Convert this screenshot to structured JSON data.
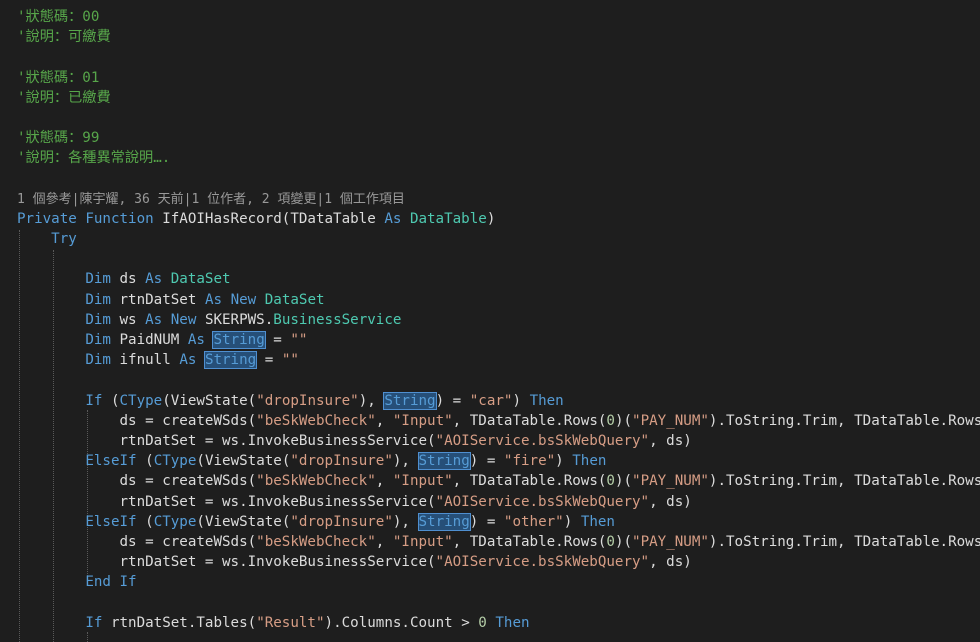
{
  "editor": {
    "lines": [
      [
        {
          "t": "'狀態碼：00",
          "c": "comment"
        }
      ],
      [
        {
          "t": "'說明：可繳費",
          "c": "comment"
        }
      ],
      [],
      [
        {
          "t": "'狀態碼：01",
          "c": "comment"
        }
      ],
      [
        {
          "t": "'說明：已繳費",
          "c": "comment"
        }
      ],
      [],
      [
        {
          "t": "'狀態碼：99",
          "c": "comment"
        }
      ],
      [
        {
          "t": "'說明：各種異常說明….",
          "c": "comment"
        }
      ],
      [],
      [
        {
          "t": "1 個參考|陳宇耀, 36 天前|1 位作者, 2 項變更|1 個工作項目",
          "c": "codelens"
        }
      ],
      [
        {
          "t": "Private ",
          "c": "kw"
        },
        {
          "t": "Function ",
          "c": "kw"
        },
        {
          "t": "IfAOIHasRecord(TDataTable ",
          "c": "plain"
        },
        {
          "t": "As ",
          "c": "kw"
        },
        {
          "t": "DataTable",
          "c": "type"
        },
        {
          "t": ")",
          "c": "plain"
        }
      ],
      [
        {
          "t": "    ",
          "c": "plain"
        },
        {
          "t": "Try",
          "c": "kw"
        }
      ],
      [],
      [
        {
          "t": "        ",
          "c": "plain"
        },
        {
          "t": "Dim ",
          "c": "kw"
        },
        {
          "t": "ds ",
          "c": "plain"
        },
        {
          "t": "As ",
          "c": "kw"
        },
        {
          "t": "DataSet",
          "c": "type"
        }
      ],
      [
        {
          "t": "        ",
          "c": "plain"
        },
        {
          "t": "Dim ",
          "c": "kw"
        },
        {
          "t": "rtnDatSet ",
          "c": "plain"
        },
        {
          "t": "As ",
          "c": "kw"
        },
        {
          "t": "New ",
          "c": "kw"
        },
        {
          "t": "DataSet",
          "c": "type"
        }
      ],
      [
        {
          "t": "        ",
          "c": "plain"
        },
        {
          "t": "Dim ",
          "c": "kw"
        },
        {
          "t": "ws ",
          "c": "plain"
        },
        {
          "t": "As ",
          "c": "kw"
        },
        {
          "t": "New ",
          "c": "kw"
        },
        {
          "t": "SKERPWS.",
          "c": "plain"
        },
        {
          "t": "BusinessService",
          "c": "type"
        }
      ],
      [
        {
          "t": "        ",
          "c": "plain"
        },
        {
          "t": "Dim ",
          "c": "kw"
        },
        {
          "t": "PaidNUM ",
          "c": "plain"
        },
        {
          "t": "As ",
          "c": "kw"
        },
        {
          "t": "String",
          "c": "hl"
        },
        {
          "t": " = ",
          "c": "plain"
        },
        {
          "t": "\"\"",
          "c": "str"
        }
      ],
      [
        {
          "t": "        ",
          "c": "plain"
        },
        {
          "t": "Dim ",
          "c": "kw"
        },
        {
          "t": "ifnull ",
          "c": "plain"
        },
        {
          "t": "As ",
          "c": "kw"
        },
        {
          "t": "String",
          "c": "hl"
        },
        {
          "t": " = ",
          "c": "plain"
        },
        {
          "t": "\"\"",
          "c": "str"
        }
      ],
      [],
      [
        {
          "t": "        ",
          "c": "plain"
        },
        {
          "t": "If ",
          "c": "kw"
        },
        {
          "t": "(",
          "c": "plain"
        },
        {
          "t": "CType",
          "c": "kw"
        },
        {
          "t": "(ViewState(",
          "c": "plain"
        },
        {
          "t": "\"dropInsure\"",
          "c": "str"
        },
        {
          "t": "), ",
          "c": "plain"
        },
        {
          "t": "String",
          "c": "hl"
        },
        {
          "t": ") = ",
          "c": "plain"
        },
        {
          "t": "\"car\"",
          "c": "str"
        },
        {
          "t": ") ",
          "c": "plain"
        },
        {
          "t": "Then",
          "c": "kw"
        }
      ],
      [
        {
          "t": "            ds = createWSds(",
          "c": "plain"
        },
        {
          "t": "\"beSkWebCheck\"",
          "c": "str"
        },
        {
          "t": ", ",
          "c": "plain"
        },
        {
          "t": "\"Input\"",
          "c": "str"
        },
        {
          "t": ", TDataTable.Rows(",
          "c": "plain"
        },
        {
          "t": "0",
          "c": "num"
        },
        {
          "t": ")(",
          "c": "plain"
        },
        {
          "t": "\"PAY_NUM\"",
          "c": "str"
        },
        {
          "t": ").ToString.Trim, TDataTable.Rows(",
          "c": "plain"
        }
      ],
      [
        {
          "t": "            rtnDatSet = ws.InvokeBusinessService(",
          "c": "plain"
        },
        {
          "t": "\"AOIService.bsSkWebQuery\"",
          "c": "str"
        },
        {
          "t": ", ds)",
          "c": "plain"
        }
      ],
      [
        {
          "t": "        ",
          "c": "plain"
        },
        {
          "t": "ElseIf ",
          "c": "kw"
        },
        {
          "t": "(",
          "c": "plain"
        },
        {
          "t": "CType",
          "c": "kw"
        },
        {
          "t": "(ViewState(",
          "c": "plain"
        },
        {
          "t": "\"dropInsure\"",
          "c": "str"
        },
        {
          "t": "), ",
          "c": "plain"
        },
        {
          "t": "String",
          "c": "hl"
        },
        {
          "t": ") = ",
          "c": "plain"
        },
        {
          "t": "\"fire\"",
          "c": "str"
        },
        {
          "t": ") ",
          "c": "plain"
        },
        {
          "t": "Then",
          "c": "kw"
        }
      ],
      [
        {
          "t": "            ds = createWSds(",
          "c": "plain"
        },
        {
          "t": "\"beSkWebCheck\"",
          "c": "str"
        },
        {
          "t": ", ",
          "c": "plain"
        },
        {
          "t": "\"Input\"",
          "c": "str"
        },
        {
          "t": ", TDataTable.Rows(",
          "c": "plain"
        },
        {
          "t": "0",
          "c": "num"
        },
        {
          "t": ")(",
          "c": "plain"
        },
        {
          "t": "\"PAY_NUM\"",
          "c": "str"
        },
        {
          "t": ").ToString.Trim, TDataTable.Rows(",
          "c": "plain"
        }
      ],
      [
        {
          "t": "            rtnDatSet = ws.InvokeBusinessService(",
          "c": "plain"
        },
        {
          "t": "\"AOIService.bsSkWebQuery\"",
          "c": "str"
        },
        {
          "t": ", ds)",
          "c": "plain"
        }
      ],
      [
        {
          "t": "        ",
          "c": "plain"
        },
        {
          "t": "ElseIf ",
          "c": "kw"
        },
        {
          "t": "(",
          "c": "plain"
        },
        {
          "t": "CType",
          "c": "kw"
        },
        {
          "t": "(ViewState(",
          "c": "plain"
        },
        {
          "t": "\"dropInsure\"",
          "c": "str"
        },
        {
          "t": "), ",
          "c": "plain"
        },
        {
          "t": "String",
          "c": "hl"
        },
        {
          "t": ") = ",
          "c": "plain"
        },
        {
          "t": "\"other\"",
          "c": "str"
        },
        {
          "t": ") ",
          "c": "plain"
        },
        {
          "t": "Then",
          "c": "kw"
        }
      ],
      [
        {
          "t": "            ds = createWSds(",
          "c": "plain"
        },
        {
          "t": "\"beSkWebCheck\"",
          "c": "str"
        },
        {
          "t": ", ",
          "c": "plain"
        },
        {
          "t": "\"Input\"",
          "c": "str"
        },
        {
          "t": ", TDataTable.Rows(",
          "c": "plain"
        },
        {
          "t": "0",
          "c": "num"
        },
        {
          "t": ")(",
          "c": "plain"
        },
        {
          "t": "\"PAY_NUM\"",
          "c": "str"
        },
        {
          "t": ").ToString.Trim, TDataTable.Rows(",
          "c": "plain"
        }
      ],
      [
        {
          "t": "            rtnDatSet = ws.InvokeBusinessService(",
          "c": "plain"
        },
        {
          "t": "\"AOIService.bsSkWebQuery\"",
          "c": "str"
        },
        {
          "t": ", ds)",
          "c": "plain"
        }
      ],
      [
        {
          "t": "        ",
          "c": "plain"
        },
        {
          "t": "End ",
          "c": "kw"
        },
        {
          "t": "If",
          "c": "kw"
        }
      ],
      [],
      [
        {
          "t": "        ",
          "c": "plain"
        },
        {
          "t": "If ",
          "c": "kw"
        },
        {
          "t": "rtnDatSet.Tables(",
          "c": "plain"
        },
        {
          "t": "\"Result\"",
          "c": "str"
        },
        {
          "t": ").Columns.Count > ",
          "c": "plain"
        },
        {
          "t": "0",
          "c": "num"
        },
        {
          "t": " ",
          "c": "plain"
        },
        {
          "t": "Then",
          "c": "kw"
        }
      ],
      []
    ]
  },
  "colors": {
    "background": "#1e1e1e",
    "comment": "#57a64a",
    "keyword": "#569cd6",
    "type": "#4ec9b0",
    "string": "#d69d85",
    "number": "#b5cea8",
    "text": "#dcdcdc",
    "highlight": "#264f78"
  }
}
